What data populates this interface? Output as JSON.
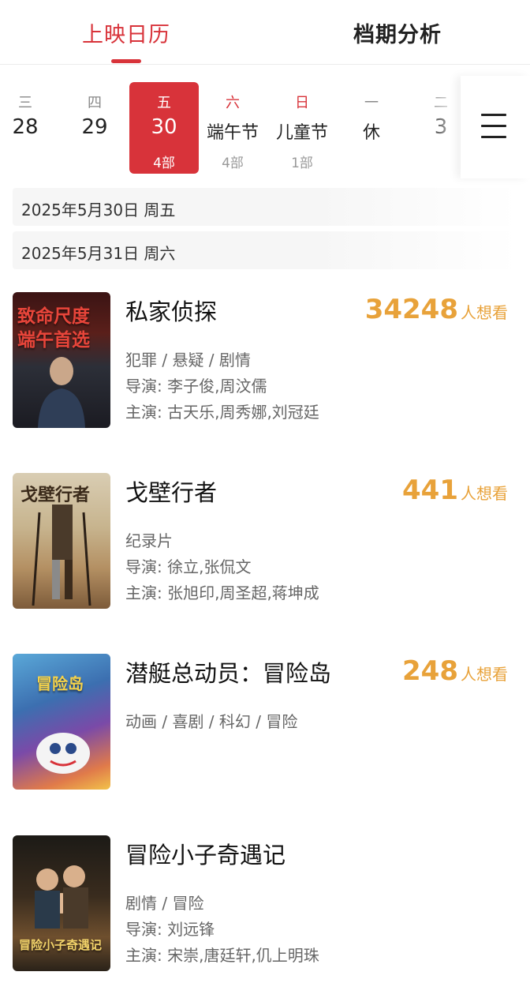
{
  "tabs": {
    "active": "上映日历",
    "other": "档期分析"
  },
  "calendar": [
    {
      "weekday": "三",
      "day": "28",
      "count": "",
      "holiday": false,
      "selected": false
    },
    {
      "weekday": "四",
      "day": "29",
      "count": "",
      "holiday": false,
      "selected": false
    },
    {
      "weekday": "五",
      "day": "30",
      "count": "4部",
      "holiday": false,
      "selected": true
    },
    {
      "weekday": "六",
      "day": "端午节",
      "count": "4部",
      "holiday": true,
      "selected": false
    },
    {
      "weekday": "日",
      "day": "儿童节",
      "count": "1部",
      "holiday": true,
      "selected": false
    },
    {
      "weekday": "一",
      "day": "休",
      "count": "",
      "holiday": false,
      "selected": false
    },
    {
      "weekday": "二",
      "day": "3",
      "count": "",
      "holiday": false,
      "selected": false
    }
  ],
  "date_headers": [
    "2025年5月30日  周五",
    "2025年5月31日  周六"
  ],
  "want_unit": "人想看",
  "movies": [
    {
      "title": "私家侦探",
      "want": "34248",
      "genre": "犯罪 / 悬疑 / 剧情",
      "director": "导演: 李子俊,周汶儒",
      "cast": "主演: 古天乐,周秀娜,刘冠廷",
      "poster_text": "致命尺度 端午首选"
    },
    {
      "title": "戈壁行者",
      "want": "441",
      "genre": "纪录片",
      "director": "导演: 徐立,张侃文",
      "cast": "主演: 张旭印,周圣超,蒋坤成",
      "poster_text": "戈壁行者"
    },
    {
      "title": "潜艇总动员：冒险岛",
      "want": "248",
      "genre": "动画 / 喜剧 / 科幻 / 冒险",
      "director": "",
      "cast": "",
      "poster_text": "冒险岛"
    },
    {
      "title": "冒险小子奇遇记",
      "want": "",
      "genre": "剧情 / 冒险",
      "director": "导演: 刘远锋",
      "cast": "主演: 宋崇,唐廷轩,仉上明珠",
      "poster_text": "冒险小子奇遇记"
    }
  ],
  "icons": {
    "menu": "menu-icon"
  },
  "colors": {
    "accent": "#d8333a",
    "want": "#e8a23a"
  }
}
